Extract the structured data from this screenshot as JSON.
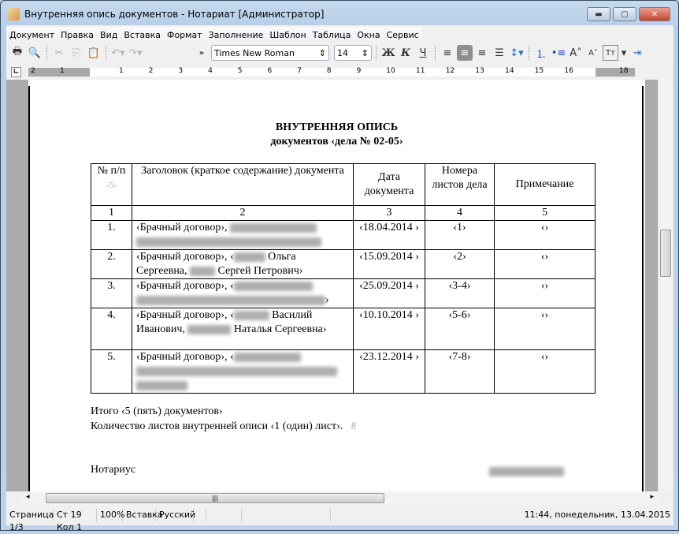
{
  "window": {
    "title": "Внутренняя опись документов - Нотариат [Администратор]"
  },
  "menu": [
    "Документ",
    "Правка",
    "Вид",
    "Вставка",
    "Формат",
    "Заполнение",
    "Шаблон",
    "Таблица",
    "Окна",
    "Сервис"
  ],
  "toolbar": {
    "font": "Times New Roman",
    "size": "14",
    "bold": "Ж",
    "italic": "К",
    "underline": "Ч",
    "more": "»"
  },
  "ruler": {
    "left": [
      "2",
      "1"
    ],
    "right": [
      "1",
      "2",
      "3",
      "4",
      "5",
      "6",
      "7",
      "8",
      "9",
      "10",
      "11",
      "12",
      "13",
      "14",
      "15",
      "16"
    ],
    "end": "18"
  },
  "doc": {
    "title": "ВНУТРЕННЯЯ ОПИСЬ",
    "subtitle": "документов ‹дела № 02-05›",
    "headers": [
      "№ п/п",
      "Заголовок (краткое содержание) документа",
      "Дата документа",
      "Номера листов дела",
      "Примечание"
    ],
    "header_hint": "‹5›",
    "col_numbers": [
      "1",
      "2",
      "3",
      "4",
      "5"
    ],
    "rows": [
      {
        "n": "1.",
        "title_a": "‹Брачный договор›, ",
        "title_b": "",
        "title_c": "",
        "date": "‹18.04.2014 ›",
        "sheets": "‹1›",
        "note": "‹›"
      },
      {
        "n": "2.",
        "title_a": "‹Брачный договор›, ‹",
        "title_b": " Ольга Сергеевна, ",
        "title_c": " Сергей Петрович›",
        "date": "‹15.09.2014 ›",
        "sheets": "‹2›",
        "note": "‹›"
      },
      {
        "n": "3.",
        "title_a": "‹Брачный договор›, ‹",
        "title_b": "",
        "title_c": "›",
        "date": "‹25.09.2014 ›",
        "sheets": "‹3-4›",
        "note": "‹›"
      },
      {
        "n": "4.",
        "title_a": "‹Брачный договор›, ‹",
        "title_b": " Василий Иванович, ",
        "title_c": " Наталья Сергеевна›",
        "date": "‹10.10.2014 ›",
        "sheets": "‹5-6›",
        "note": "‹›"
      },
      {
        "n": "5.",
        "title_a": "‹Брачный договор›, ‹",
        "title_b": "",
        "title_c": "",
        "date": "‹23.12.2014 ›",
        "sheets": "‹7-8›",
        "note": "‹›"
      }
    ],
    "total": "Итого ‹5 (пять) документов›",
    "sheets_count": "Количество листов внутренней описи ‹1 (один) лист›.",
    "sheets_hint": "8",
    "notary": "Нотариус"
  },
  "status": {
    "page": "Страница 1/3",
    "pos": "Ст 19  Кол 1",
    "zoom": "100%",
    "mode": "Вставка",
    "lang": "Русский",
    "datetime": "11:44, понедельник, 13.04.2015"
  }
}
